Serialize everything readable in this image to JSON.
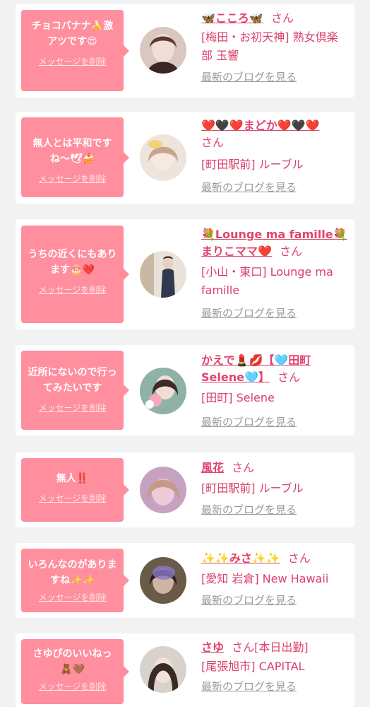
{
  "delete_label": "メッセージを削除",
  "san_label": "さん",
  "blog_label": "最新のブログを見る",
  "colors": {
    "bubble": "#ff8e9e",
    "accent": "#e0436d",
    "link_gray": "#9a9a9a"
  },
  "cards": [
    {
      "message": "チョコバナナ🍌激アツです😍",
      "name": "🦋こころ🦋",
      "shop": "[梅田・お初天神] 熟女倶楽部 玉響"
    },
    {
      "message": "無人とは平和ですね〜🕊🍰",
      "name": "❤️🖤❤️まどか❤️🖤❤️",
      "shop": "[町田駅前] ルーブル"
    },
    {
      "message": "うちの近くにもあります🎂❤️",
      "name": "💐Lounge ma famille💐まりこママ❤️",
      "shop": "[小山・東口] Lounge ma famille"
    },
    {
      "message": "近所にないので行ってみたいです",
      "name": "かえで💄💋【🩵田町Selene🩵】",
      "shop": "[田町] Selene"
    },
    {
      "message": "無人‼️",
      "name": "風花",
      "shop": "[町田駅前] ルーブル"
    },
    {
      "message": "いろんなのがありますね✨✨",
      "name": "✨✨みさ✨✨",
      "shop": "[愛知 岩倉] New Hawaii"
    },
    {
      "message": "さゆぴのいいねっ🧸🤎",
      "name": "さゆ",
      "suffix": "[本日出勤]",
      "shop": "[尾張旭市] CAPITAL"
    }
  ]
}
